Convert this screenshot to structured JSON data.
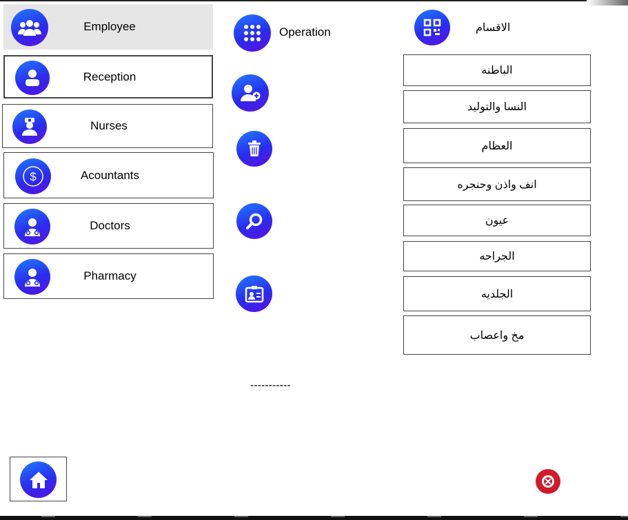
{
  "sidebar": {
    "items": [
      {
        "label": "Employee",
        "icon": "users-group-icon"
      },
      {
        "label": "Reception",
        "icon": "user-icon"
      },
      {
        "label": "Nurses",
        "icon": "nurse-icon"
      },
      {
        "label": "Acountants",
        "icon": "dollar-icon"
      },
      {
        "label": "Doctors",
        "icon": "doctor-icon"
      },
      {
        "label": "Pharmacy",
        "icon": "doctor-icon"
      }
    ]
  },
  "actions": {
    "operation_label": "Operation",
    "separator": "-----------"
  },
  "departments": {
    "title": "الاقسام",
    "items": [
      "الباطنه",
      "النسا والتوليد",
      "العظام",
      "انف واذن وحنجره",
      "عيون",
      "الجراحه",
      "الجلديه",
      "مخ واعصاب"
    ]
  },
  "colors": {
    "accent_start": "#1f7bff",
    "accent_end": "#5a11e0",
    "close": "#d11a2a"
  }
}
